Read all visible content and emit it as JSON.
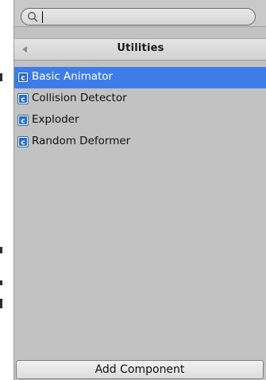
{
  "search": {
    "value": "",
    "placeholder": ""
  },
  "header": {
    "title": "Utilities"
  },
  "list": {
    "items": [
      {
        "label": "Basic Animator",
        "icon": "csharp-script-icon",
        "selected": true
      },
      {
        "label": "Collision Detector",
        "icon": "csharp-script-icon",
        "selected": false
      },
      {
        "label": "Exploder",
        "icon": "csharp-script-icon",
        "selected": false
      },
      {
        "label": "Random Deformer",
        "icon": "csharp-script-icon",
        "selected": false
      }
    ]
  },
  "footer": {
    "add_component_label": "Add Component"
  },
  "colors": {
    "selection": "#3e7de7",
    "panel_background": "#c2c2c2",
    "icon_blue": "#2f6fbf"
  }
}
